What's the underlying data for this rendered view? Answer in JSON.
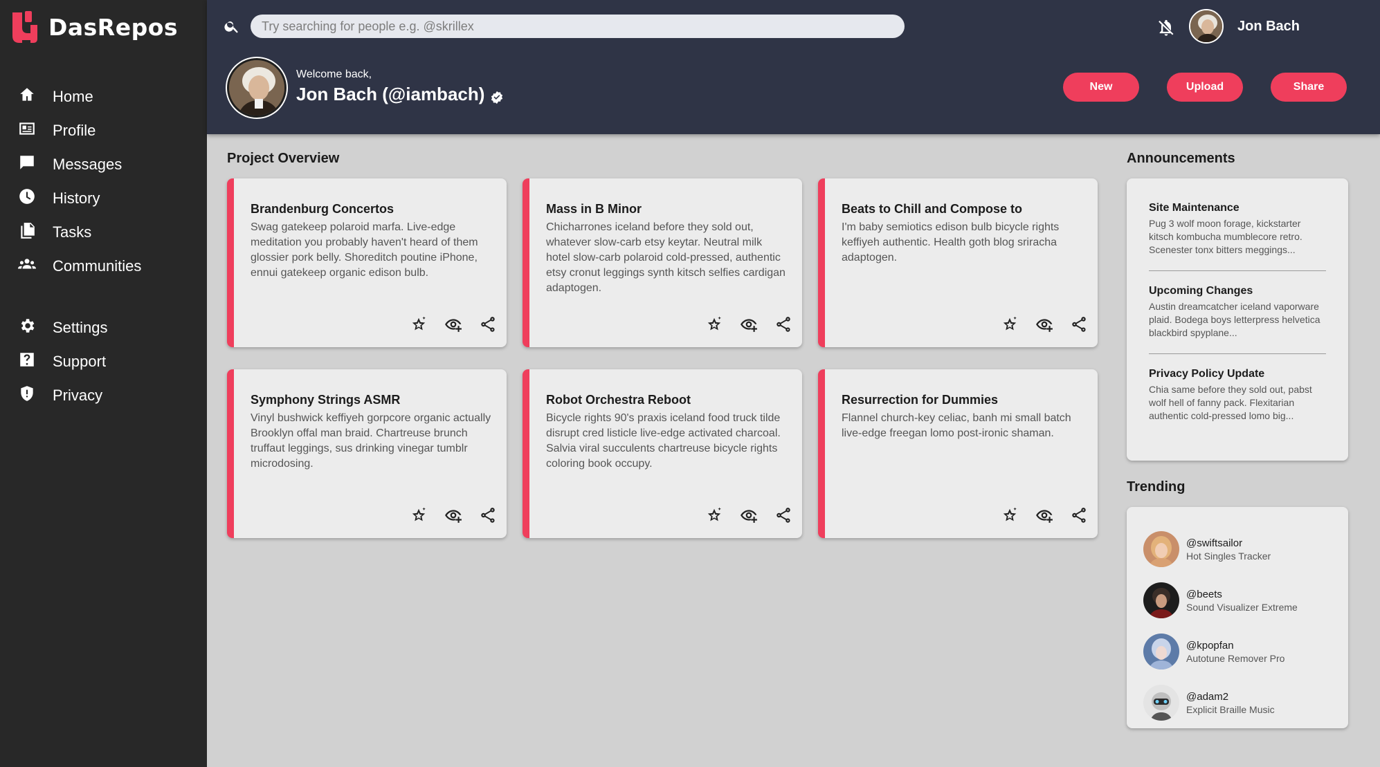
{
  "app": {
    "name": "DasRepos",
    "brand_color": "#ef3e5c"
  },
  "sidebar": {
    "items": [
      {
        "label": "Home",
        "icon": "home-icon"
      },
      {
        "label": "Profile",
        "icon": "profile-card-icon"
      },
      {
        "label": "Messages",
        "icon": "message-icon"
      },
      {
        "label": "History",
        "icon": "clock-icon"
      },
      {
        "label": "Tasks",
        "icon": "documents-icon"
      },
      {
        "label": "Communities",
        "icon": "people-icon"
      }
    ],
    "secondary": [
      {
        "label": "Settings",
        "icon": "gear-icon"
      },
      {
        "label": "Support",
        "icon": "help-icon"
      },
      {
        "label": "Privacy",
        "icon": "shield-icon"
      }
    ]
  },
  "header": {
    "search_placeholder": "Try searching for people e.g. @skrillex",
    "user_name": "Jon Bach",
    "welcome": "Welcome back,",
    "handle": "Jon Bach (@iambach)",
    "buttons": {
      "new": "New",
      "upload": "Upload",
      "share": "Share"
    }
  },
  "projects": {
    "title": "Project Overview",
    "cards": [
      {
        "title": "Brandenburg Concertos",
        "text": "Swag gatekeep polaroid marfa. Live-edge meditation you probably haven't heard of them glossier pork belly. Shoreditch poutine iPhone, ennui gatekeep organic edison bulb."
      },
      {
        "title": "Mass in B Minor",
        "text": "Chicharrones iceland before they sold out, whatever slow-carb etsy keytar. Neutral milk hotel slow-carb polaroid cold-pressed, authentic etsy cronut leggings synth kitsch selfies cardigan adaptogen."
      },
      {
        "title": "Beats to Chill and Compose to",
        "text": "I'm baby semiotics edison bulb bicycle rights keffiyeh authentic. Health goth blog sriracha adaptogen."
      },
      {
        "title": "Symphony Strings ASMR",
        "text": "Vinyl bushwick keffiyeh gorpcore organic actually Brooklyn offal man braid. Chartreuse brunch truffaut leggings, sus drinking vinegar tumblr microdosing."
      },
      {
        "title": "Robot Orchestra Reboot",
        "text": "Bicycle rights 90's praxis iceland food truck tilde disrupt cred listicle live-edge activated charcoal. Salvia viral succulents chartreuse bicycle rights coloring book occupy."
      },
      {
        "title": "Resurrection for Dummies",
        "text": "Flannel church-key celiac, banh mi small batch live-edge freegan lomo post-ironic shaman."
      }
    ]
  },
  "announcements": {
    "title": "Announcements",
    "items": [
      {
        "title": "Site Maintenance",
        "text": "Pug 3 wolf moon forage, kickstarter kitsch kombucha mumblecore retro. Scenester tonx bitters meggings..."
      },
      {
        "title": "Upcoming Changes",
        "text": "Austin dreamcatcher iceland vaporware plaid. Bodega boys letterpress helvetica blackbird spyplane..."
      },
      {
        "title": "Privacy Policy Update",
        "text": "Chia same before they sold out, pabst wolf hell of fanny pack. Flexitarian authentic cold-pressed lomo big..."
      }
    ]
  },
  "trending": {
    "title": "Trending",
    "items": [
      {
        "handle": "@swiftsailor",
        "project": "Hot Singles Tracker"
      },
      {
        "handle": "@beets",
        "project": "Sound Visualizer Extreme"
      },
      {
        "handle": "@kpopfan",
        "project": "Autotune Remover Pro"
      },
      {
        "handle": "@adam2",
        "project": "Explicit Braille Music"
      }
    ]
  }
}
